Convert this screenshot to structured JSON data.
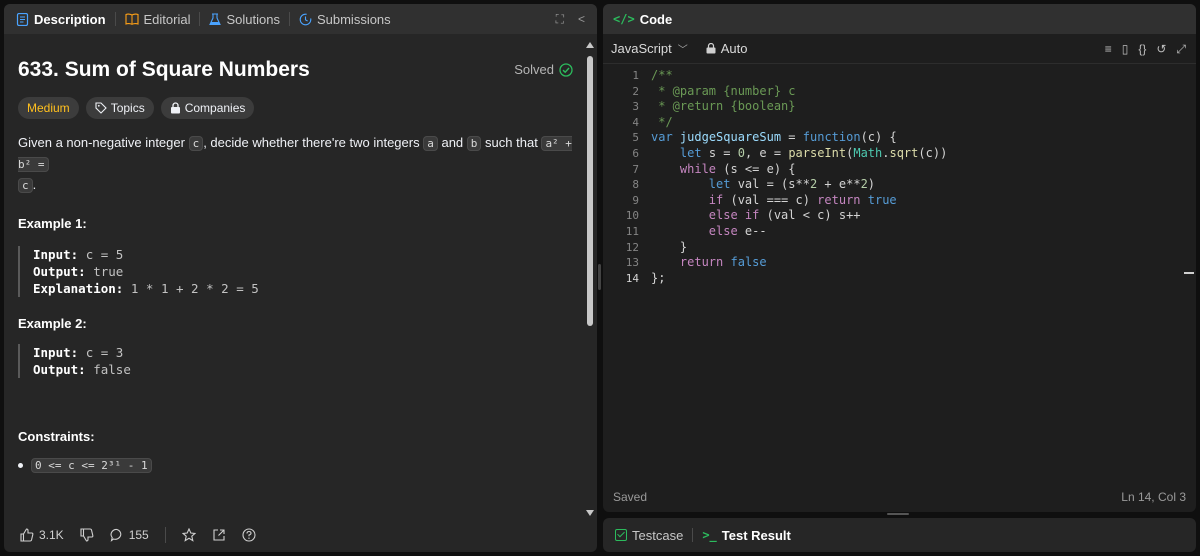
{
  "left_tabs": [
    {
      "label": "Description",
      "icon": "document-icon",
      "active": true
    },
    {
      "label": "Editorial",
      "icon": "book-icon",
      "active": false
    },
    {
      "label": "Solutions",
      "icon": "flask-icon",
      "active": false
    },
    {
      "label": "Submissions",
      "icon": "history-icon",
      "active": false
    }
  ],
  "problem": {
    "title": "633. Sum of Square Numbers",
    "status": "Solved",
    "difficulty": "Medium",
    "topics_label": "Topics",
    "companies_label": "Companies",
    "desc_1": "Given a non-negative integer",
    "desc_c": "c",
    "desc_2": ", decide whether there're two integers",
    "desc_a": "a",
    "desc_and": "and",
    "desc_b": "b",
    "desc_3": "such that",
    "desc_eq": "a² + b² =",
    "desc_c2": "c",
    "desc_end": "."
  },
  "example1": {
    "heading": "Example 1:",
    "input_label": "Input:",
    "input_value": "c = 5",
    "output_label": "Output:",
    "output_value": "true",
    "explanation_label": "Explanation:",
    "explanation_value": "1 * 1 + 2 * 2 = 5"
  },
  "example2": {
    "heading": "Example 2:",
    "input_label": "Input:",
    "input_value": "c = 3",
    "output_label": "Output:",
    "output_value": "false"
  },
  "constraints": {
    "heading": "Constraints:",
    "item": "0 <= c <= 2³¹ - 1"
  },
  "footer": {
    "likes": "3.1K",
    "comments": "155"
  },
  "code_panel": {
    "title": "Code",
    "language": "JavaScript",
    "mode": "Auto",
    "status_left": "Saved",
    "status_right": "Ln 14, Col 3"
  },
  "code_lines": [
    {
      "n": "1"
    },
    {
      "n": "2"
    },
    {
      "n": "3"
    },
    {
      "n": "4"
    },
    {
      "n": "5"
    },
    {
      "n": "6"
    },
    {
      "n": "7"
    },
    {
      "n": "8"
    },
    {
      "n": "9"
    },
    {
      "n": "10"
    },
    {
      "n": "11"
    },
    {
      "n": "12"
    },
    {
      "n": "13"
    },
    {
      "n": "14"
    }
  ],
  "code": {
    "l1": "/**",
    "l2": " * @param {number} c",
    "l3": " * @return {boolean}",
    "l4": " */",
    "l5_var": "var",
    "l5_name": "judgeSquareSum",
    "l5_eq": " = ",
    "l5_fn": "function",
    "l5_rest": "(c) {",
    "l6_let": "let",
    "l6_rest": " s = ",
    "l6_zero": "0",
    "l6_mid": ", e = ",
    "l6_parse": "parseInt",
    "l6_p1": "(",
    "l6_math": "Math",
    "l6_dot": ".",
    "l6_sqrt": "sqrt",
    "l6_end": "(c))",
    "l7_while": "while",
    "l7_rest": " (s <= e) {",
    "l8_let": "let",
    "l8_rest": " val = (s**",
    "l8_two": "2",
    "l8_mid": " + e**",
    "l8_two2": "2",
    "l8_end": ")",
    "l9_if": "if",
    "l9_rest": " (val === c) ",
    "l9_return": "return",
    "l9_true": " true",
    "l10_else": "else if",
    "l10_rest": " (val < c) s++",
    "l11_else": "else",
    "l11_rest": " e--",
    "l12": "}",
    "l13_return": "return",
    "l13_false": " false",
    "l14": "};"
  },
  "bottom_tabs": {
    "testcase": "Testcase",
    "test_result": "Test Result"
  },
  "colors": {
    "accent_green": "#2cbb5d",
    "medium_yellow": "#ffc01e",
    "panel_bg": "#262626",
    "editor_bg": "#1e1e1e"
  }
}
